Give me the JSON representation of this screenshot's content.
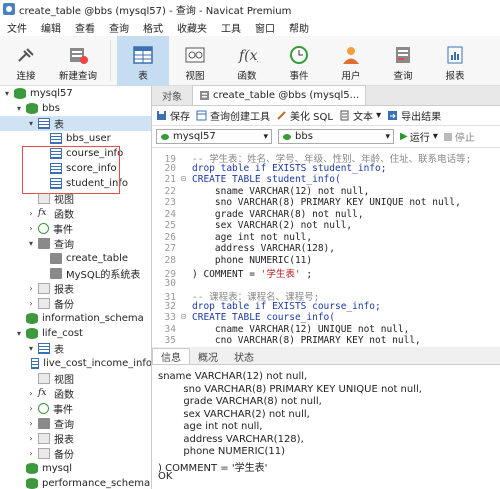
{
  "title": "create_table @bbs (mysql57) - 查询 - Navicat Premium",
  "menu": [
    "文件",
    "编辑",
    "查看",
    "查询",
    "格式",
    "收藏夹",
    "工具",
    "窗口",
    "帮助"
  ],
  "toolbar": [
    "连接",
    "新建查询",
    "表",
    "视图",
    "函数",
    "事件",
    "用户",
    "查询",
    "报表"
  ],
  "sidebar": {
    "rows": [
      {
        "label": "mysql57",
        "indent": 0,
        "arrow": "▾",
        "icon": "db"
      },
      {
        "label": "bbs",
        "indent": 1,
        "arrow": "▾",
        "icon": "db"
      },
      {
        "label": "表",
        "indent": 2,
        "arrow": "▾",
        "icon": "tbl",
        "selected": true
      },
      {
        "label": "bbs_user",
        "indent": 3,
        "arrow": "",
        "icon": "tbl"
      },
      {
        "label": "course_info",
        "indent": 3,
        "arrow": "",
        "icon": "tbl"
      },
      {
        "label": "score_info",
        "indent": 3,
        "arrow": "",
        "icon": "tbl"
      },
      {
        "label": "student_info",
        "indent": 3,
        "arrow": "",
        "icon": "tbl"
      },
      {
        "label": "视图",
        "indent": 2,
        "arrow": "",
        "icon": "folder"
      },
      {
        "label": "函数",
        "indent": 2,
        "arrow": "›",
        "icon": "fx"
      },
      {
        "label": "事件",
        "indent": 2,
        "arrow": "›",
        "icon": "clock"
      },
      {
        "label": "查询",
        "indent": 2,
        "arrow": "▾",
        "icon": "qry"
      },
      {
        "label": "create_table",
        "indent": 3,
        "arrow": "",
        "icon": "qry"
      },
      {
        "label": "MySQL的系统表",
        "indent": 3,
        "arrow": "",
        "icon": "qry"
      },
      {
        "label": "报表",
        "indent": 2,
        "arrow": "›",
        "icon": "folder"
      },
      {
        "label": "备份",
        "indent": 2,
        "arrow": "›",
        "icon": "folder"
      },
      {
        "label": "information_schema",
        "indent": 1,
        "arrow": "",
        "icon": "db"
      },
      {
        "label": "life_cost",
        "indent": 1,
        "arrow": "▾",
        "icon": "db"
      },
      {
        "label": "表",
        "indent": 2,
        "arrow": "▾",
        "icon": "tbl"
      },
      {
        "label": "live_cost_income_info",
        "indent": 3,
        "arrow": "",
        "icon": "tbl"
      },
      {
        "label": "视图",
        "indent": 2,
        "arrow": "",
        "icon": "folder"
      },
      {
        "label": "函数",
        "indent": 2,
        "arrow": "›",
        "icon": "fx"
      },
      {
        "label": "事件",
        "indent": 2,
        "arrow": "›",
        "icon": "clock"
      },
      {
        "label": "查询",
        "indent": 2,
        "arrow": "›",
        "icon": "qry"
      },
      {
        "label": "报表",
        "indent": 2,
        "arrow": "›",
        "icon": "folder"
      },
      {
        "label": "备份",
        "indent": 2,
        "arrow": "›",
        "icon": "folder"
      },
      {
        "label": "mysql",
        "indent": 1,
        "arrow": "",
        "icon": "db"
      },
      {
        "label": "performance_schema",
        "indent": 1,
        "arrow": "",
        "icon": "db"
      }
    ]
  },
  "tabs": {
    "objects": "对象",
    "query": "create_table @bbs (mysql5..."
  },
  "qtool": [
    "保存",
    "查询创建工具",
    "美化 SQL",
    "文本",
    "导出结果"
  ],
  "selectors": {
    "connection": "mysql57",
    "database": "bbs",
    "run": "运行",
    "stop": "停止"
  },
  "code": [
    {
      "n": "19",
      "t": "cm",
      "s": "-- 学生表：姓名、学号、年级、性别、年龄、住址、联系电话等;"
    },
    {
      "n": "20",
      "t": "kw",
      "s": "drop table if EXISTS student_info;"
    },
    {
      "n": "21",
      "t": "kw",
      "s": "CREATE TABLE student_info(",
      "fold": true
    },
    {
      "n": "22",
      "t": "x",
      "s": "    sname VARCHAR(12) not null,"
    },
    {
      "n": "23",
      "t": "x",
      "s": "    sno VARCHAR(8) PRIMARY KEY UNIQUE not null,"
    },
    {
      "n": "24",
      "t": "x",
      "s": "    grade VARCHAR(8) not null,"
    },
    {
      "n": "25",
      "t": "x",
      "s": "    sex VARCHAR(2) not null,"
    },
    {
      "n": "26",
      "t": "x",
      "s": "    age int not null,"
    },
    {
      "n": "27",
      "t": "x",
      "s": "    address VARCHAR(128),"
    },
    {
      "n": "28",
      "t": "x",
      "s": "    phone NUMERIC(11)"
    },
    {
      "n": "29",
      "t": "x",
      "s": ") COMMENT = '学生表' ;"
    },
    {
      "n": "30",
      "t": "x",
      "s": ""
    },
    {
      "n": "31",
      "t": "cm",
      "s": "-- 课程表：课程名、课程号;"
    },
    {
      "n": "32",
      "t": "kw",
      "s": "drop table if EXISTS course_info;"
    },
    {
      "n": "33",
      "t": "kw",
      "s": "CREATE TABLE course_info(",
      "fold": true
    },
    {
      "n": "34",
      "t": "x",
      "s": "    cname VARCHAR(12) UNIQUE not null,"
    },
    {
      "n": "35",
      "t": "x",
      "s": "    cno VARCHAR(8) PRIMARY KEY not null,"
    }
  ],
  "bottom_tabs": [
    "信息",
    "概况",
    "状态"
  ],
  "output": [
    "sname VARCHAR(12) not null,",
    "        sno VARCHAR(8) PRIMARY KEY UNIQUE not null,",
    "        grade VARCHAR(8) not null,",
    "        sex VARCHAR(2) not null,",
    "        age int not null,",
    "        address VARCHAR(128),",
    "        phone NUMERIC(11)",
    ") COMMENT = '学生表'",
    "OK"
  ]
}
